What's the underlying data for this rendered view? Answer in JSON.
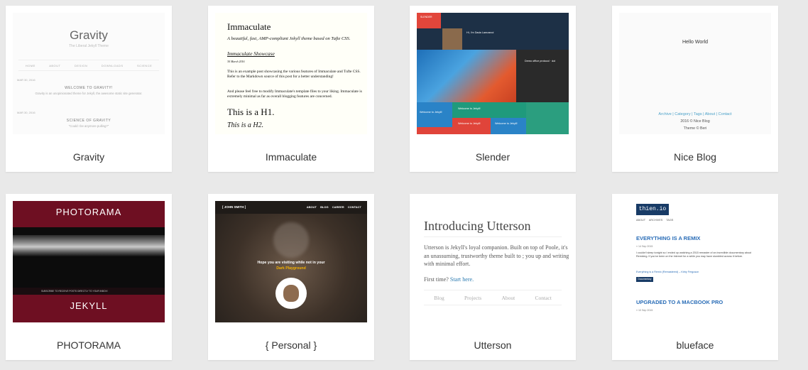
{
  "themes": [
    {
      "title": "Gravity"
    },
    {
      "title": "Immaculate"
    },
    {
      "title": "Slender"
    },
    {
      "title": "Nice Blog"
    },
    {
      "title": "PHOTORAMA"
    },
    {
      "title": "{ Personal }"
    },
    {
      "title": "Utterson"
    },
    {
      "title": "blueface"
    }
  ],
  "gravity": {
    "heading": "Gravity",
    "tagline": "The Liberal Jekyll Theme",
    "nav": [
      "HOME",
      "ABOUT",
      "DESIGN",
      "DOWNLOADS",
      "SCIENCE"
    ],
    "post1_date": "MAR 30, 2016",
    "post1_title": "WELCOME TO GRAVITY!",
    "post1_excerpt": "Gravity is an unopinionated theme for Jekyll, the awesome static site generator.",
    "post2_date": "MAR 30, 2016",
    "post2_title": "SCIENCE OF GRAVITY",
    "post2_excerpt": "\"Could I be anymore pulling?\""
  },
  "immaculate": {
    "title": "Immaculate",
    "tagline": "A beautiful, fast, AMP-compliant Jekyll theme based on Tufte CSS.",
    "post_title": "Immaculate Showcase",
    "post_date": "30 March 2016",
    "para1": "This is an example post showcasing the various features of Immaculate and Tufte CSS. Refer to the Markdown source of this post for a better understanding!",
    "para2": "And please feel free to modify Immaculate's template files to your liking. Immaculate is extremely minimal as far as overall blogging features are concerned.",
    "h1": "This is a H1.",
    "h2": "This is a H2."
  },
  "slender": {
    "brand": "SLENDER",
    "profile": "Hi, I'm Dada Lamzanoi",
    "tile_a": "Welcome to Jekyll!",
    "tile_b": "Welcome to Jekyll!",
    "tile_c": "Welcome to Jekyll!",
    "tile_d": "Demo office protocol · dol",
    "tile_e": "Welcome to Jekyll!"
  },
  "niceblog": {
    "hello": "Hello World",
    "links": "Archive | Category | Tags | About | Contact",
    "footer": "2016 © Nice Blog",
    "theme_by": "Theme © Beri"
  },
  "photorama": {
    "title": "PHOTORAMA",
    "subtitle": "JEKYLL",
    "subscribe": "SUBSCRIBE TO RECEIVE POSTS DIRECTLY TO YOUR INBOX!"
  },
  "personal": {
    "brand": "[ JOHN SMITH ]",
    "nav": "ABOUT BLOG CAREER CONTACT",
    "message": "Hope you are visiting while not in your",
    "message2": "Dark Playground"
  },
  "utterson": {
    "title": "Introducing Utterson",
    "para": "Utterson is Jekyll's loyal companion. Built on top of Poole, it's an unassuming, trustworthy theme built to ; you up and writing with minimal effort.",
    "question": "First time?",
    "link": "Start here.",
    "nav": [
      "Blog",
      "Projects",
      "About",
      "Contact"
    ]
  },
  "blueface": {
    "logo": "thien.io",
    "nav": "ABOUT ARCHIVES TAGS",
    "post1_title": "EVERYTHING IS A REMIX",
    "post1_date": "» 14 Sep 2015",
    "post1_text": "I couldn't sleep tonight so I ended up watching a 2015 remaster of an incredible documentary about Remixing. If you've been on the Internet for a while you may have stumbled across it before.",
    "post1_link": "Everything is a Remix (Remastered) – Kirby Ferguson",
    "post1_tag": "Documentary",
    "post2_title": "UPGRADED TO A MACBOOK PRO",
    "post2_date": "» 10 Sep 2015"
  },
  "colors": {
    "page_bg": "#e9e9e9",
    "card_bg": "#ffffff",
    "photorama_red": "#6e0f22",
    "slender_navy": "#1d3046",
    "blueface_navy": "#183b66"
  }
}
